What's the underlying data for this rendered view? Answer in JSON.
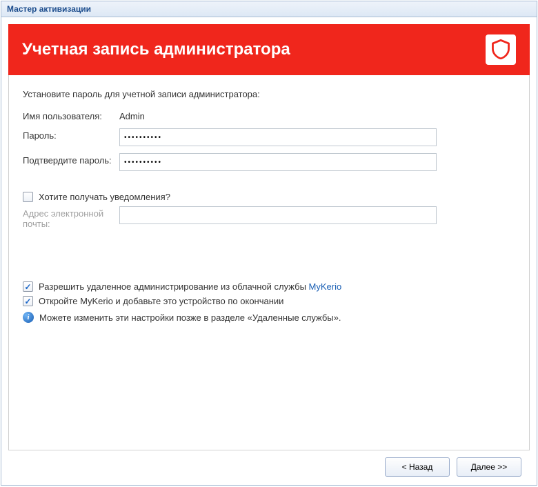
{
  "window": {
    "title": "Мастер активизации"
  },
  "header": {
    "title": "Учетная запись администратора"
  },
  "form": {
    "instruction": "Установите пароль для учетной записи администратора:",
    "username_label": "Имя пользователя:",
    "username_value": "Admin",
    "password_label": "Пароль:",
    "password_value": "••••••••••",
    "confirm_label": "Подтвердите пароль:",
    "confirm_value": "••••••••••",
    "notifications_label": "Хотите получать уведомления?",
    "notifications_checked": false,
    "email_label": "Адрес электронной почты:",
    "email_value": ""
  },
  "remote": {
    "allow_checked": true,
    "allow_text_prefix": "Разрешить удаленное администрирование из облачной службы ",
    "allow_link": "MyKerio",
    "open_checked": true,
    "open_text": "Откройте MyKerio и добавьте это устройство по окончании",
    "info_text": "Можете изменить эти настройки позже в разделе «Удаленные службы»."
  },
  "footer": {
    "back_label": "< Назад",
    "next_label": "Далее >>"
  },
  "colors": {
    "accent": "#f0261c",
    "link": "#1a5fb4"
  }
}
